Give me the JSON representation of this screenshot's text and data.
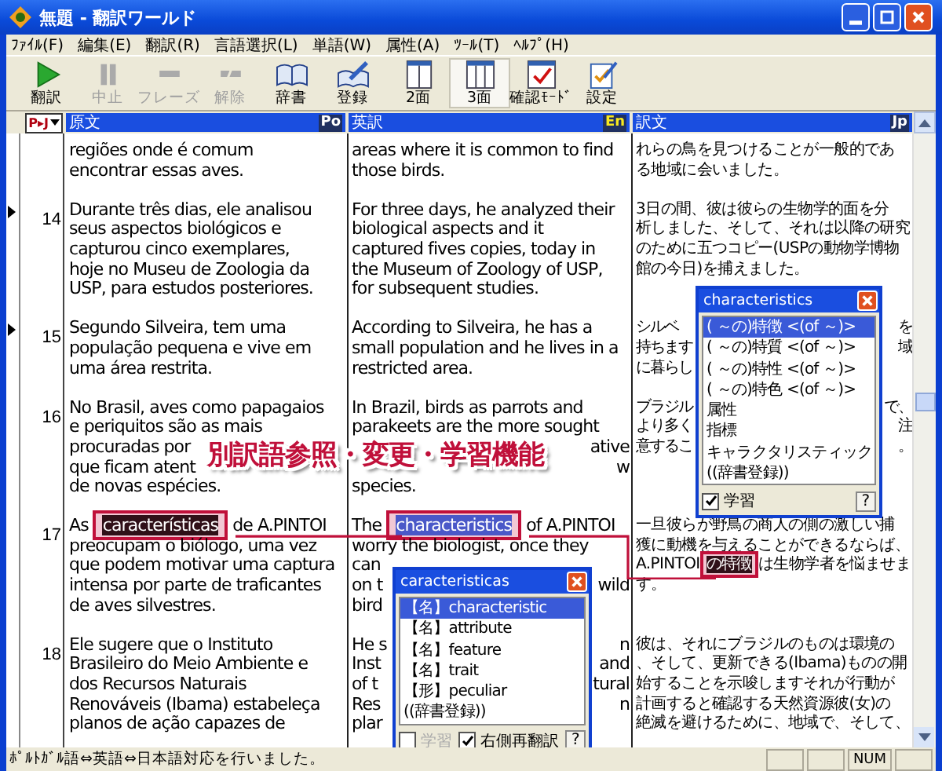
{
  "window": {
    "title": "無題 - 翻訳ワールド"
  },
  "menu": [
    "ﾌｧｲﾙ(F)",
    "編集(E)",
    "翻訳(R)",
    "言語選択(L)",
    "単語(W)",
    "属性(A)",
    "ﾂｰﾙ(T)",
    "ﾍﾙﾌﾟ(H)"
  ],
  "toolbar": [
    {
      "label": "翻訳",
      "kind": "play",
      "disabled": false,
      "selected": false
    },
    {
      "label": "中止",
      "kind": "pause",
      "disabled": true,
      "selected": false
    },
    {
      "label": "フレーズ",
      "kind": "phrase",
      "disabled": true,
      "selected": false
    },
    {
      "label": "解除",
      "kind": "release",
      "disabled": true,
      "selected": false
    },
    {
      "label": "辞書",
      "kind": "book",
      "disabled": false,
      "selected": false
    },
    {
      "label": "登録",
      "kind": "register",
      "disabled": false,
      "selected": false
    },
    {
      "label": "2面",
      "kind": "two",
      "disabled": false,
      "selected": false
    },
    {
      "label": "3面",
      "kind": "three",
      "disabled": false,
      "selected": true
    },
    {
      "label": "確認ﾓｰﾄﾞ",
      "kind": "check",
      "disabled": false,
      "selected": false
    },
    {
      "label": "設定",
      "kind": "settings",
      "disabled": false,
      "selected": false
    }
  ],
  "direction": "P▸J",
  "columns": [
    {
      "title": "原文",
      "badge": "Po"
    },
    {
      "title": "英訳",
      "badge": "En"
    },
    {
      "title": "訳文",
      "badge": "Jp"
    }
  ],
  "rows": [
    {
      "number": "",
      "marked": false,
      "source": [
        "regiões onde é comum",
        "encontrar essas aves."
      ],
      "english": [
        "areas where it is common to find",
        "those birds."
      ],
      "japanese": [
        "れらの鳥を見つけることが一般的であ",
        "る地域に会いました。"
      ]
    },
    {
      "number": "14",
      "marked": true,
      "source": [
        "Durante três dias, ele analisou",
        "seus aspectos biológicos e",
        "capturou cinco exemplares,",
        "hoje no Museu de Zoologia da",
        "USP, para estudos posteriores."
      ],
      "english": [
        "For three days, he analyzed their",
        "biological aspects and it",
        "captured fives copies, today in",
        "the Museum of Zoology of USP,",
        "for subsequent studies."
      ],
      "japanese": [
        "3日の間、彼は彼らの生物学的面を分",
        "析しました、そして、それは以降の研究",
        "のために五つコピー(USPの動物学博物",
        "館の今日)を捕えました。"
      ]
    },
    {
      "number": "15",
      "marked": true,
      "source": [
        "Segundo Silveira, tem uma",
        "população pequena e vive em",
        "uma área restrita."
      ],
      "english": [
        "According to Silveira, he has a",
        "small population and he lives in a",
        "restricted area."
      ],
      "japanese": [
        {
          "text": "シルベ",
          "right": "を"
        },
        {
          "text": "持ちます",
          "right": "域"
        },
        {
          "text": "に暮らし"
        }
      ]
    },
    {
      "number": "16",
      "marked": false,
      "source": [
        "No Brasil, aves como papagaios",
        "e periquitos são as mais",
        "procuradas por",
        "que ficam atent",
        "de novas espécies."
      ],
      "english": [
        "In Brazil, birds as parrots and",
        "parakeets are the more sought",
        {
          "right": "ative"
        },
        {
          "right": "w"
        },
        "species."
      ],
      "japanese": [
        {
          "text": "ブラジル",
          "right": "で、"
        },
        {
          "text": "より多く",
          "right": "注"
        },
        {
          "text": "意するこ",
          "right": "。"
        }
      ]
    },
    {
      "number": "17",
      "marked": false,
      "source": [
        {
          "before": "As ",
          "highlight": "características",
          "after": " de A.PINTOI",
          "kind": "dark"
        },
        "preocupam o biólogo, uma vez",
        "que podem motivar uma captura",
        "intensa por parte de traficantes",
        "de aves silvestres."
      ],
      "english": [
        {
          "before": "The ",
          "highlight": "characteristics",
          "after": " of A.PINTOI",
          "kind": "selected"
        },
        "worry the biologist, once they",
        "can",
        {
          "text": "on t",
          "right": "wild"
        },
        "bird"
      ],
      "japanese": [
        "一旦彼らが野鳥の商人の側の激しい捕",
        "獲に動機を与えることができるならば、",
        {
          "before": "A.PINTOI",
          "highlight": "の特徴",
          "after": "は生物学者を悩ませま",
          "kind": "dark"
        },
        "す。"
      ]
    },
    {
      "number": "18",
      "marked": false,
      "source": [
        "Ele sugere que o Instituto",
        "Brasileiro do Meio Ambiente e",
        "dos Recursos Naturais",
        "Renováveis (Ibama) estabeleça",
        "planos de ação capazes de"
      ],
      "english": [
        {
          "text": "He s",
          "right": "n"
        },
        {
          "text": "Inst",
          "right": "and"
        },
        {
          "text": "of t",
          "right": "tural"
        },
        {
          "text": "Res",
          "right": "n"
        },
        "plar"
      ],
      "japanese": [
        "彼は、それにブラジルのものは環境の",
        "、そして、更新できる(Ibama)ものの開",
        "始することを示唆しますそれが行動が",
        "計画すると確認する天然資源彼(女)の",
        "絶滅を避けるために、地域で、そして、"
      ]
    }
  ],
  "banner": "別訳語参照・変更・学習機能",
  "popups": [
    {
      "title": "characteristics",
      "kind": "japanese",
      "items": [
        {
          "label": "( ～の)特徴 <(of ～)>",
          "selected": true
        },
        {
          "label": "( ～の)特質 <(of ～)>",
          "selected": false
        },
        {
          "label": "( ～の)特性 <(of ～)>",
          "selected": false
        },
        {
          "label": "( ～の)特色 <(of ～)>",
          "selected": false
        },
        {
          "label": "属性",
          "selected": false
        },
        {
          "label": "指標",
          "selected": false
        },
        {
          "label": "キャラクタリスティック",
          "selected": false
        },
        {
          "label": "((辞書登録))",
          "selected": false
        }
      ],
      "options": [
        {
          "label": "学習",
          "checked": true,
          "disabled": false
        }
      ],
      "help": "?"
    },
    {
      "title": "caracteristicas",
      "kind": "english",
      "items": [
        {
          "label": "【名】characteristic",
          "selected": true
        },
        {
          "label": "【名】attribute",
          "selected": false
        },
        {
          "label": "【名】feature",
          "selected": false
        },
        {
          "label": "【名】trait",
          "selected": false
        },
        {
          "label": "【形】peculiar",
          "selected": false
        },
        {
          "label": "((辞書登録))",
          "selected": false
        }
      ],
      "options": [
        {
          "label": "学習",
          "checked": false,
          "disabled": true
        },
        {
          "label": "右側再翻訳",
          "checked": true,
          "disabled": false
        }
      ],
      "help": "?"
    }
  ],
  "status_bar": {
    "message": "ﾎﾟﾙﾄｶﾞﾙ語⇔英語⇔日本語対応を行いました。",
    "panels": [
      "NUM"
    ]
  }
}
